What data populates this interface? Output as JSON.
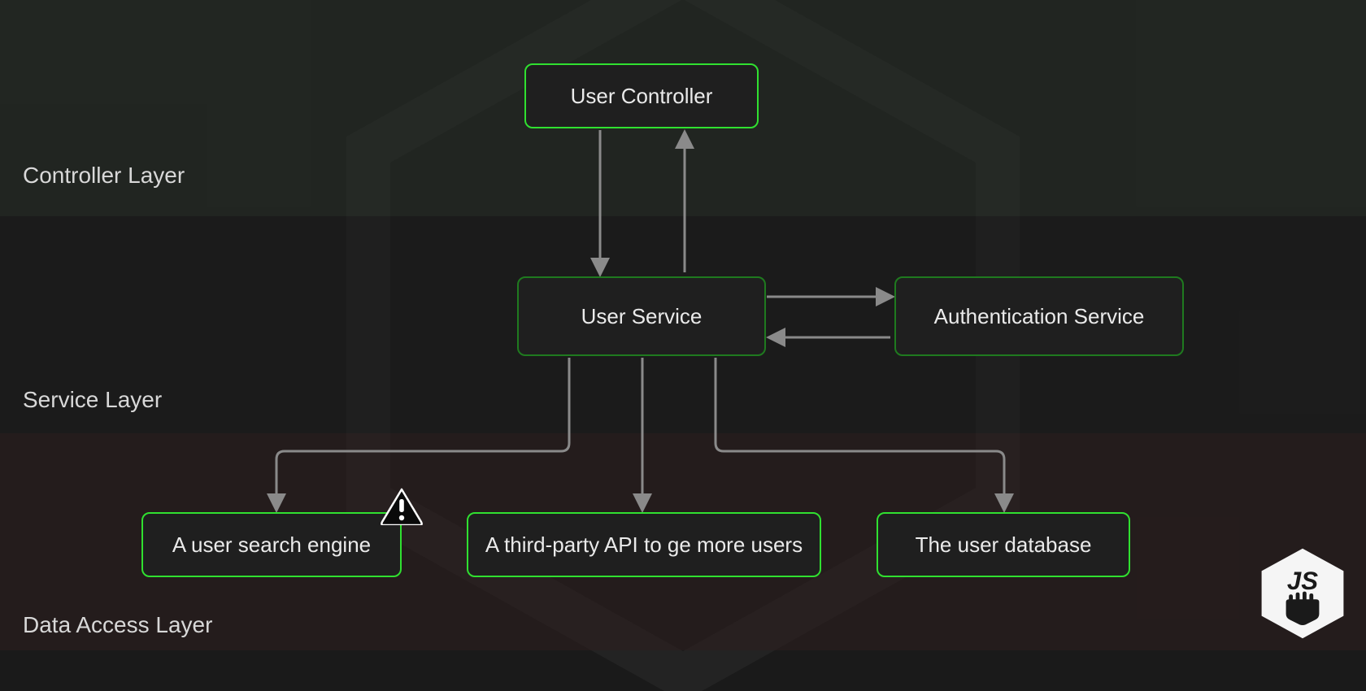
{
  "layers": {
    "controller": {
      "label": "Controller Layer"
    },
    "service": {
      "label": "Service Layer"
    },
    "data": {
      "label": "Data Access Layer"
    }
  },
  "nodes": {
    "user_controller": {
      "label": "User Controller"
    },
    "user_service": {
      "label": "User  Service"
    },
    "auth_service": {
      "label": "Authentication Service"
    },
    "search_engine": {
      "label": "A user search engine"
    },
    "third_party": {
      "label": "A third-party API to ge more users"
    },
    "user_db": {
      "label": "The user database"
    }
  },
  "colors": {
    "node_border_bright": "#30e030",
    "node_border_dark": "#1f7a1f",
    "arrow": "#8a8a8a",
    "text": "#eaeaea"
  }
}
